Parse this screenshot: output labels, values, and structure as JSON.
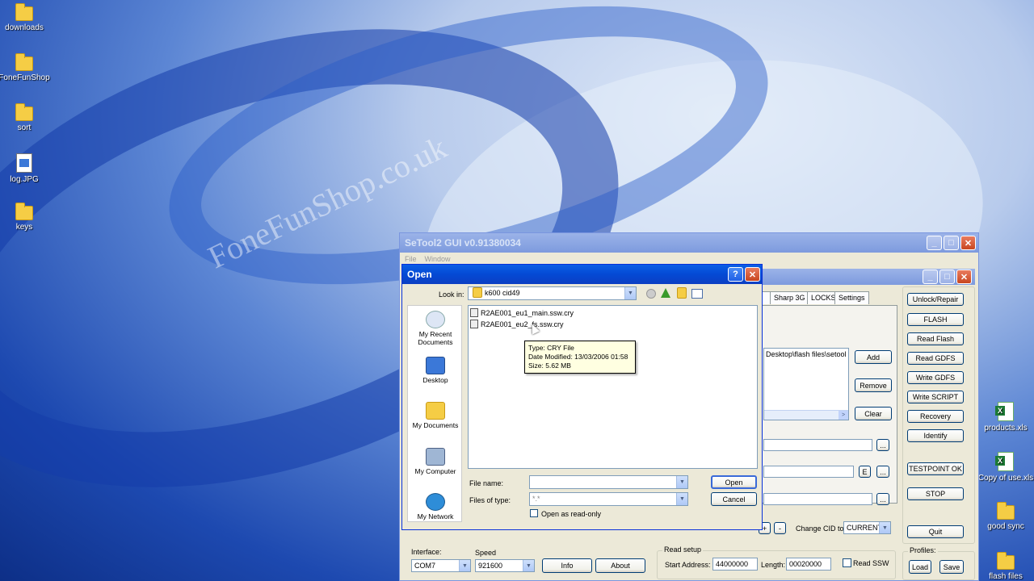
{
  "desktop": {
    "watermark": "FoneFunShop.co.uk",
    "left_icons": [
      {
        "label": "downloads",
        "type": "folder"
      },
      {
        "label": "FoneFunShop",
        "type": "folder"
      },
      {
        "label": "sort",
        "type": "folder"
      },
      {
        "label": "log.JPG",
        "type": "jpg"
      },
      {
        "label": "keys",
        "type": "folder"
      }
    ],
    "right_icons": [
      {
        "label": "products.xls",
        "type": "xls"
      },
      {
        "label": "Copy of use.xls",
        "type": "xls"
      },
      {
        "label": "good sync",
        "type": "folder"
      },
      {
        "label": "flash files",
        "type": "folder"
      }
    ]
  },
  "setool": {
    "title": "SeTool2 GUI v0.91380034",
    "menu": [
      "File",
      "Window"
    ],
    "tabs": [
      "Sharp 3G",
      "LOCKS",
      "Settings"
    ],
    "side_buttons": [
      "Unlock/Repair",
      "FLASH",
      "Read Flash",
      "Read GDFS",
      "Write GDFS",
      "Write SCRIPT",
      "Recovery",
      "Identify",
      "TESTPOINT OK",
      "STOP",
      "Quit"
    ],
    "flash_path": "Desktop\\flash files\\setool f",
    "add_label": "Add",
    "remove_label": "Remove",
    "clear_label": "Clear",
    "browse_label": "...",
    "e_label": "E",
    "plus_label": "+",
    "minus_label": "-",
    "cid_label": "Change CID to",
    "cid_value": "CURRENT",
    "interface_label": "Interface:",
    "interface_value": "COM7",
    "speed_label": "Speed",
    "speed_value": "921600",
    "info_label": "Info",
    "about_label": "About",
    "read_setup_title": "Read setup",
    "start_address_label": "Start Address:",
    "start_address_value": "44000000",
    "length_label": "Length:",
    "length_value": "00020000",
    "read_ssw_label": "Read SSW",
    "profiles_title": "Profiles:",
    "load_label": "Load",
    "save_label": "Save"
  },
  "open_dialog": {
    "title": "Open",
    "help_glyph": "?",
    "close_glyph": "✕",
    "look_in_label": "Look in:",
    "look_in_value": "k600 cid49",
    "places": [
      "My Recent Documents",
      "Desktop",
      "My Documents",
      "My Computer",
      "My Network"
    ],
    "files": [
      "R2AE001_eu1_main.ssw.cry",
      "R2AE001_eu2_fs.ssw.cry"
    ],
    "tooltip": {
      "type": "Type: CRY File",
      "modified": "Date Modified: 13/03/2006 01:58",
      "size": "Size: 5.62 MB"
    },
    "file_name_label": "File name:",
    "file_name_value": "",
    "files_of_type_label": "Files of type:",
    "files_of_type_value": "*.*",
    "read_only_label": "Open as read-only",
    "open_label": "Open",
    "cancel_label": "Cancel"
  }
}
